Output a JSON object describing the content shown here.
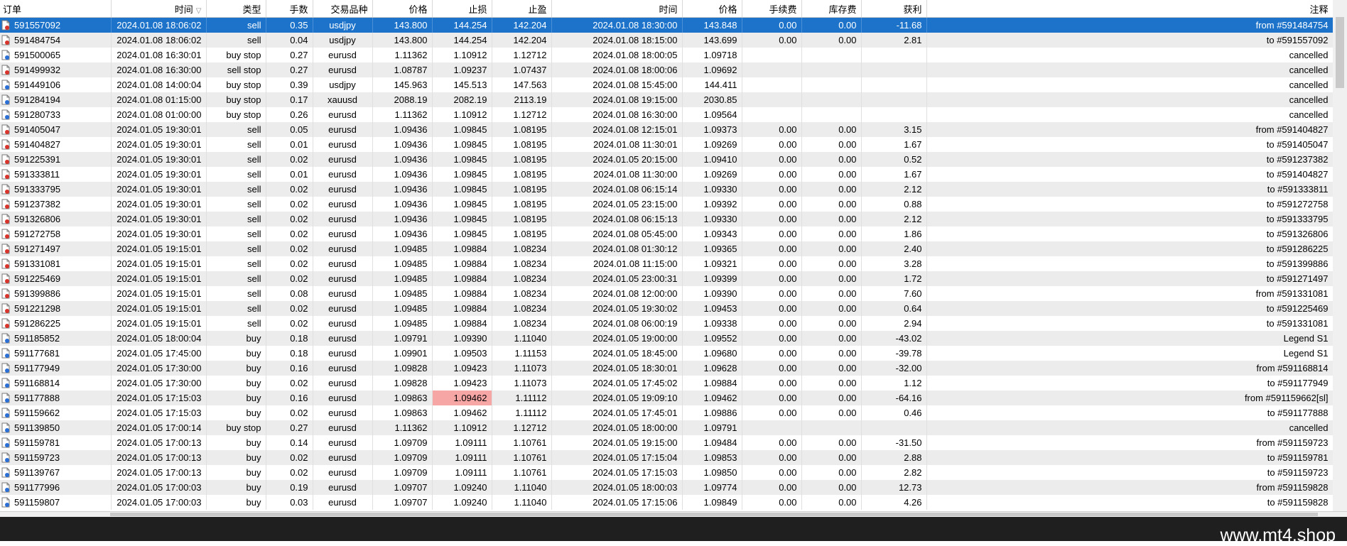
{
  "columns": [
    "订单",
    "时间",
    "类型",
    "手数",
    "交易品种",
    "价格",
    "止损",
    "止盈",
    "时间",
    "价格",
    "手续费",
    "库存费",
    "获利",
    "注释"
  ],
  "colors": {
    "selected": "#1c73c9",
    "alt_row": "#ececec",
    "stoploss_highlight": "#f7a6a6"
  },
  "rows": [
    {
      "order": "591557092",
      "open_time": "2024.01.08 18:06:02",
      "type": "sell",
      "lots": "0.35",
      "symbol": "usdjpy",
      "price": "143.800",
      "sl": "144.254",
      "tp": "142.204",
      "close_time": "2024.01.08 18:30:00",
      "close_price": "143.848",
      "commission": "0.00",
      "swap": "0.00",
      "profit": "-11.68",
      "comment": "from #591484754",
      "selected": true
    },
    {
      "order": "591484754",
      "open_time": "2024.01.08 18:06:02",
      "type": "sell",
      "lots": "0.04",
      "symbol": "usdjpy",
      "price": "143.800",
      "sl": "144.254",
      "tp": "142.204",
      "close_time": "2024.01.08 18:15:00",
      "close_price": "143.699",
      "commission": "0.00",
      "swap": "0.00",
      "profit": "2.81",
      "comment": "to #591557092"
    },
    {
      "order": "591500065",
      "open_time": "2024.01.08 16:30:01",
      "type": "buy stop",
      "lots": "0.27",
      "symbol": "eurusd",
      "price": "1.11362",
      "sl": "1.10912",
      "tp": "1.12712",
      "close_time": "2024.01.08 18:00:05",
      "close_price": "1.09718",
      "commission": "",
      "swap": "",
      "profit": "",
      "comment": "cancelled"
    },
    {
      "order": "591499932",
      "open_time": "2024.01.08 16:30:00",
      "type": "sell stop",
      "lots": "0.27",
      "symbol": "eurusd",
      "price": "1.08787",
      "sl": "1.09237",
      "tp": "1.07437",
      "close_time": "2024.01.08 18:00:06",
      "close_price": "1.09692",
      "commission": "",
      "swap": "",
      "profit": "",
      "comment": "cancelled"
    },
    {
      "order": "591449106",
      "open_time": "2024.01.08 14:00:04",
      "type": "buy stop",
      "lots": "0.39",
      "symbol": "usdjpy",
      "price": "145.963",
      "sl": "145.513",
      "tp": "147.563",
      "close_time": "2024.01.08 15:45:00",
      "close_price": "144.411",
      "commission": "",
      "swap": "",
      "profit": "",
      "comment": "cancelled"
    },
    {
      "order": "591284194",
      "open_time": "2024.01.08 01:15:00",
      "type": "buy stop",
      "lots": "0.17",
      "symbol": "xauusd",
      "price": "2088.19",
      "sl": "2082.19",
      "tp": "2113.19",
      "close_time": "2024.01.08 19:15:00",
      "close_price": "2030.85",
      "commission": "",
      "swap": "",
      "profit": "",
      "comment": "cancelled"
    },
    {
      "order": "591280733",
      "open_time": "2024.01.08 01:00:00",
      "type": "buy stop",
      "lots": "0.26",
      "symbol": "eurusd",
      "price": "1.11362",
      "sl": "1.10912",
      "tp": "1.12712",
      "close_time": "2024.01.08 16:30:00",
      "close_price": "1.09564",
      "commission": "",
      "swap": "",
      "profit": "",
      "comment": "cancelled"
    },
    {
      "order": "591405047",
      "open_time": "2024.01.05 19:30:01",
      "type": "sell",
      "lots": "0.05",
      "symbol": "eurusd",
      "price": "1.09436",
      "sl": "1.09845",
      "tp": "1.08195",
      "close_time": "2024.01.08 12:15:01",
      "close_price": "1.09373",
      "commission": "0.00",
      "swap": "0.00",
      "profit": "3.15",
      "comment": "from #591404827"
    },
    {
      "order": "591404827",
      "open_time": "2024.01.05 19:30:01",
      "type": "sell",
      "lots": "0.01",
      "symbol": "eurusd",
      "price": "1.09436",
      "sl": "1.09845",
      "tp": "1.08195",
      "close_time": "2024.01.08 11:30:01",
      "close_price": "1.09269",
      "commission": "0.00",
      "swap": "0.00",
      "profit": "1.67",
      "comment": "to #591405047"
    },
    {
      "order": "591225391",
      "open_time": "2024.01.05 19:30:01",
      "type": "sell",
      "lots": "0.02",
      "symbol": "eurusd",
      "price": "1.09436",
      "sl": "1.09845",
      "tp": "1.08195",
      "close_time": "2024.01.05 20:15:00",
      "close_price": "1.09410",
      "commission": "0.00",
      "swap": "0.00",
      "profit": "0.52",
      "comment": "to #591237382"
    },
    {
      "order": "591333811",
      "open_time": "2024.01.05 19:30:01",
      "type": "sell",
      "lots": "0.01",
      "symbol": "eurusd",
      "price": "1.09436",
      "sl": "1.09845",
      "tp": "1.08195",
      "close_time": "2024.01.08 11:30:00",
      "close_price": "1.09269",
      "commission": "0.00",
      "swap": "0.00",
      "profit": "1.67",
      "comment": "to #591404827"
    },
    {
      "order": "591333795",
      "open_time": "2024.01.05 19:30:01",
      "type": "sell",
      "lots": "0.02",
      "symbol": "eurusd",
      "price": "1.09436",
      "sl": "1.09845",
      "tp": "1.08195",
      "close_time": "2024.01.08 06:15:14",
      "close_price": "1.09330",
      "commission": "0.00",
      "swap": "0.00",
      "profit": "2.12",
      "comment": "to #591333811"
    },
    {
      "order": "591237382",
      "open_time": "2024.01.05 19:30:01",
      "type": "sell",
      "lots": "0.02",
      "symbol": "eurusd",
      "price": "1.09436",
      "sl": "1.09845",
      "tp": "1.08195",
      "close_time": "2024.01.05 23:15:00",
      "close_price": "1.09392",
      "commission": "0.00",
      "swap": "0.00",
      "profit": "0.88",
      "comment": "to #591272758"
    },
    {
      "order": "591326806",
      "open_time": "2024.01.05 19:30:01",
      "type": "sell",
      "lots": "0.02",
      "symbol": "eurusd",
      "price": "1.09436",
      "sl": "1.09845",
      "tp": "1.08195",
      "close_time": "2024.01.08 06:15:13",
      "close_price": "1.09330",
      "commission": "0.00",
      "swap": "0.00",
      "profit": "2.12",
      "comment": "to #591333795"
    },
    {
      "order": "591272758",
      "open_time": "2024.01.05 19:30:01",
      "type": "sell",
      "lots": "0.02",
      "symbol": "eurusd",
      "price": "1.09436",
      "sl": "1.09845",
      "tp": "1.08195",
      "close_time": "2024.01.08 05:45:00",
      "close_price": "1.09343",
      "commission": "0.00",
      "swap": "0.00",
      "profit": "1.86",
      "comment": "to #591326806"
    },
    {
      "order": "591271497",
      "open_time": "2024.01.05 19:15:01",
      "type": "sell",
      "lots": "0.02",
      "symbol": "eurusd",
      "price": "1.09485",
      "sl": "1.09884",
      "tp": "1.08234",
      "close_time": "2024.01.08 01:30:12",
      "close_price": "1.09365",
      "commission": "0.00",
      "swap": "0.00",
      "profit": "2.40",
      "comment": "to #591286225"
    },
    {
      "order": "591331081",
      "open_time": "2024.01.05 19:15:01",
      "type": "sell",
      "lots": "0.02",
      "symbol": "eurusd",
      "price": "1.09485",
      "sl": "1.09884",
      "tp": "1.08234",
      "close_time": "2024.01.08 11:15:00",
      "close_price": "1.09321",
      "commission": "0.00",
      "swap": "0.00",
      "profit": "3.28",
      "comment": "to #591399886"
    },
    {
      "order": "591225469",
      "open_time": "2024.01.05 19:15:01",
      "type": "sell",
      "lots": "0.02",
      "symbol": "eurusd",
      "price": "1.09485",
      "sl": "1.09884",
      "tp": "1.08234",
      "close_time": "2024.01.05 23:00:31",
      "close_price": "1.09399",
      "commission": "0.00",
      "swap": "0.00",
      "profit": "1.72",
      "comment": "to #591271497"
    },
    {
      "order": "591399886",
      "open_time": "2024.01.05 19:15:01",
      "type": "sell",
      "lots": "0.08",
      "symbol": "eurusd",
      "price": "1.09485",
      "sl": "1.09884",
      "tp": "1.08234",
      "close_time": "2024.01.08 12:00:00",
      "close_price": "1.09390",
      "commission": "0.00",
      "swap": "0.00",
      "profit": "7.60",
      "comment": "from #591331081"
    },
    {
      "order": "591221298",
      "open_time": "2024.01.05 19:15:01",
      "type": "sell",
      "lots": "0.02",
      "symbol": "eurusd",
      "price": "1.09485",
      "sl": "1.09884",
      "tp": "1.08234",
      "close_time": "2024.01.05 19:30:02",
      "close_price": "1.09453",
      "commission": "0.00",
      "swap": "0.00",
      "profit": "0.64",
      "comment": "to #591225469"
    },
    {
      "order": "591286225",
      "open_time": "2024.01.05 19:15:01",
      "type": "sell",
      "lots": "0.02",
      "symbol": "eurusd",
      "price": "1.09485",
      "sl": "1.09884",
      "tp": "1.08234",
      "close_time": "2024.01.08 06:00:19",
      "close_price": "1.09338",
      "commission": "0.00",
      "swap": "0.00",
      "profit": "2.94",
      "comment": "to #591331081"
    },
    {
      "order": "591185852",
      "open_time": "2024.01.05 18:00:04",
      "type": "buy",
      "lots": "0.18",
      "symbol": "eurusd",
      "price": "1.09791",
      "sl": "1.09390",
      "tp": "1.11040",
      "close_time": "2024.01.05 19:00:00",
      "close_price": "1.09552",
      "commission": "0.00",
      "swap": "0.00",
      "profit": "-43.02",
      "comment": "Legend  S1"
    },
    {
      "order": "591177681",
      "open_time": "2024.01.05 17:45:00",
      "type": "buy",
      "lots": "0.18",
      "symbol": "eurusd",
      "price": "1.09901",
      "sl": "1.09503",
      "tp": "1.11153",
      "close_time": "2024.01.05 18:45:00",
      "close_price": "1.09680",
      "commission": "0.00",
      "swap": "0.00",
      "profit": "-39.78",
      "comment": "Legend  S1"
    },
    {
      "order": "591177949",
      "open_time": "2024.01.05 17:30:00",
      "type": "buy",
      "lots": "0.16",
      "symbol": "eurusd",
      "price": "1.09828",
      "sl": "1.09423",
      "tp": "1.11073",
      "close_time": "2024.01.05 18:30:01",
      "close_price": "1.09628",
      "commission": "0.00",
      "swap": "0.00",
      "profit": "-32.00",
      "comment": "from #591168814"
    },
    {
      "order": "591168814",
      "open_time": "2024.01.05 17:30:00",
      "type": "buy",
      "lots": "0.02",
      "symbol": "eurusd",
      "price": "1.09828",
      "sl": "1.09423",
      "tp": "1.11073",
      "close_time": "2024.01.05 17:45:02",
      "close_price": "1.09884",
      "commission": "0.00",
      "swap": "0.00",
      "profit": "1.12",
      "comment": "to #591177949"
    },
    {
      "order": "591177888",
      "open_time": "2024.01.05 17:15:03",
      "type": "buy",
      "lots": "0.16",
      "symbol": "eurusd",
      "price": "1.09863",
      "sl": "1.09462",
      "tp": "1.11112",
      "close_time": "2024.01.05 19:09:10",
      "close_price": "1.09462",
      "commission": "0.00",
      "swap": "0.00",
      "profit": "-64.16",
      "comment": "from #591159662[sl]",
      "sl_hit": true
    },
    {
      "order": "591159662",
      "open_time": "2024.01.05 17:15:03",
      "type": "buy",
      "lots": "0.02",
      "symbol": "eurusd",
      "price": "1.09863",
      "sl": "1.09462",
      "tp": "1.11112",
      "close_time": "2024.01.05 17:45:01",
      "close_price": "1.09886",
      "commission": "0.00",
      "swap": "0.00",
      "profit": "0.46",
      "comment": "to #591177888"
    },
    {
      "order": "591139850",
      "open_time": "2024.01.05 17:00:14",
      "type": "buy stop",
      "lots": "0.27",
      "symbol": "eurusd",
      "price": "1.11362",
      "sl": "1.10912",
      "tp": "1.12712",
      "close_time": "2024.01.05 18:00:00",
      "close_price": "1.09791",
      "commission": "",
      "swap": "",
      "profit": "",
      "comment": "cancelled"
    },
    {
      "order": "591159781",
      "open_time": "2024.01.05 17:00:13",
      "type": "buy",
      "lots": "0.14",
      "symbol": "eurusd",
      "price": "1.09709",
      "sl": "1.09111",
      "tp": "1.10761",
      "close_time": "2024.01.05 19:15:00",
      "close_price": "1.09484",
      "commission": "0.00",
      "swap": "0.00",
      "profit": "-31.50",
      "comment": "from #591159723"
    },
    {
      "order": "591159723",
      "open_time": "2024.01.05 17:00:13",
      "type": "buy",
      "lots": "0.02",
      "symbol": "eurusd",
      "price": "1.09709",
      "sl": "1.09111",
      "tp": "1.10761",
      "close_time": "2024.01.05 17:15:04",
      "close_price": "1.09853",
      "commission": "0.00",
      "swap": "0.00",
      "profit": "2.88",
      "comment": "to #591159781"
    },
    {
      "order": "591139767",
      "open_time": "2024.01.05 17:00:13",
      "type": "buy",
      "lots": "0.02",
      "symbol": "eurusd",
      "price": "1.09709",
      "sl": "1.09111",
      "tp": "1.10761",
      "close_time": "2024.01.05 17:15:03",
      "close_price": "1.09850",
      "commission": "0.00",
      "swap": "0.00",
      "profit": "2.82",
      "comment": "to #591159723"
    },
    {
      "order": "591177996",
      "open_time": "2024.01.05 17:00:03",
      "type": "buy",
      "lots": "0.19",
      "symbol": "eurusd",
      "price": "1.09707",
      "sl": "1.09240",
      "tp": "1.11040",
      "close_time": "2024.01.05 18:00:03",
      "close_price": "1.09774",
      "commission": "0.00",
      "swap": "0.00",
      "profit": "12.73",
      "comment": "from #591159828"
    },
    {
      "order": "591159807",
      "open_time": "2024.01.05 17:00:03",
      "type": "buy",
      "lots": "0.03",
      "symbol": "eurusd",
      "price": "1.09707",
      "sl": "1.09240",
      "tp": "1.11040",
      "close_time": "2024.01.05 17:15:06",
      "close_price": "1.09849",
      "commission": "0.00",
      "swap": "0.00",
      "profit": "4.26",
      "comment": "to #591159828"
    }
  ],
  "footer": {
    "watermark": "www.mt4.shop"
  }
}
